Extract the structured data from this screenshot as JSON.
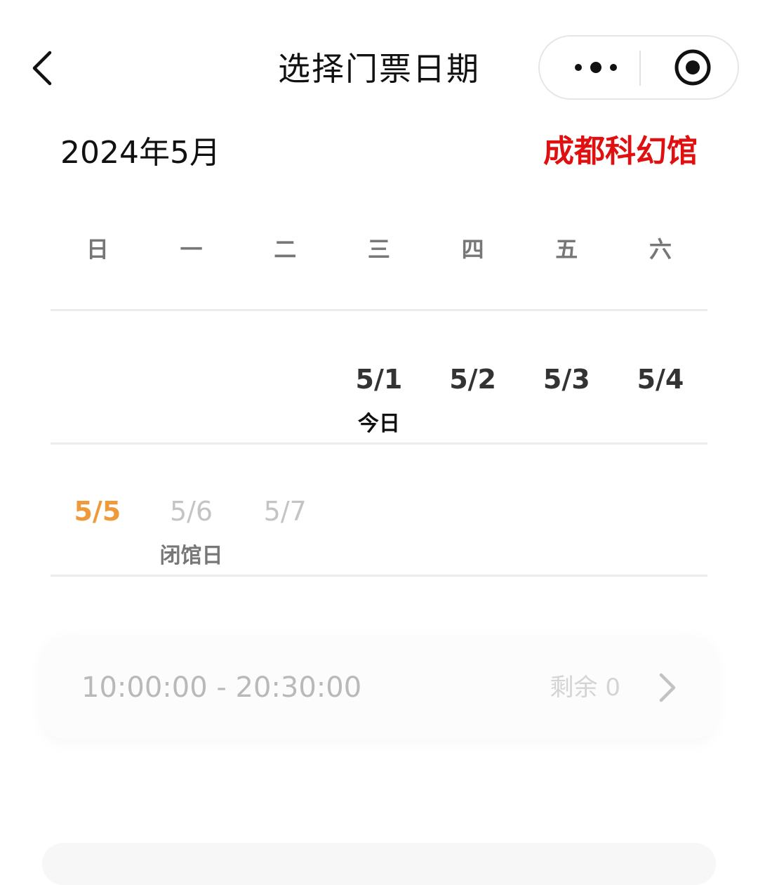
{
  "header": {
    "title": "选择门票日期",
    "back_icon": "chevron-left-icon",
    "more_icon": "more-dots-icon",
    "close_icon": "target-circle-icon"
  },
  "calendar": {
    "month": "2024年5月",
    "venue": "成都科幻馆",
    "weekdays": [
      "日",
      "一",
      "二",
      "三",
      "四",
      "五",
      "六"
    ],
    "week1": [
      {
        "date": "",
        "note": ""
      },
      {
        "date": "",
        "note": ""
      },
      {
        "date": "",
        "note": ""
      },
      {
        "date": "5/1",
        "note": "今日"
      },
      {
        "date": "5/2",
        "note": ""
      },
      {
        "date": "5/3",
        "note": ""
      },
      {
        "date": "5/4",
        "note": ""
      }
    ],
    "week2": [
      {
        "date": "5/5",
        "note": "",
        "state": "selected"
      },
      {
        "date": "5/6",
        "note": "闭馆日",
        "state": "disabled"
      },
      {
        "date": "5/7",
        "note": "",
        "state": "disabled"
      },
      {
        "date": "",
        "note": ""
      },
      {
        "date": "",
        "note": ""
      },
      {
        "date": "",
        "note": ""
      },
      {
        "date": "",
        "note": ""
      }
    ]
  },
  "session": {
    "time_range": "10:00:00 - 20:30:00",
    "remaining": "剩余 0",
    "arrow_icon": "chevron-right-icon"
  },
  "colors": {
    "venue": "#e01010",
    "selected_date": "#ee9a3a",
    "disabled_date": "#c4c4c4"
  }
}
